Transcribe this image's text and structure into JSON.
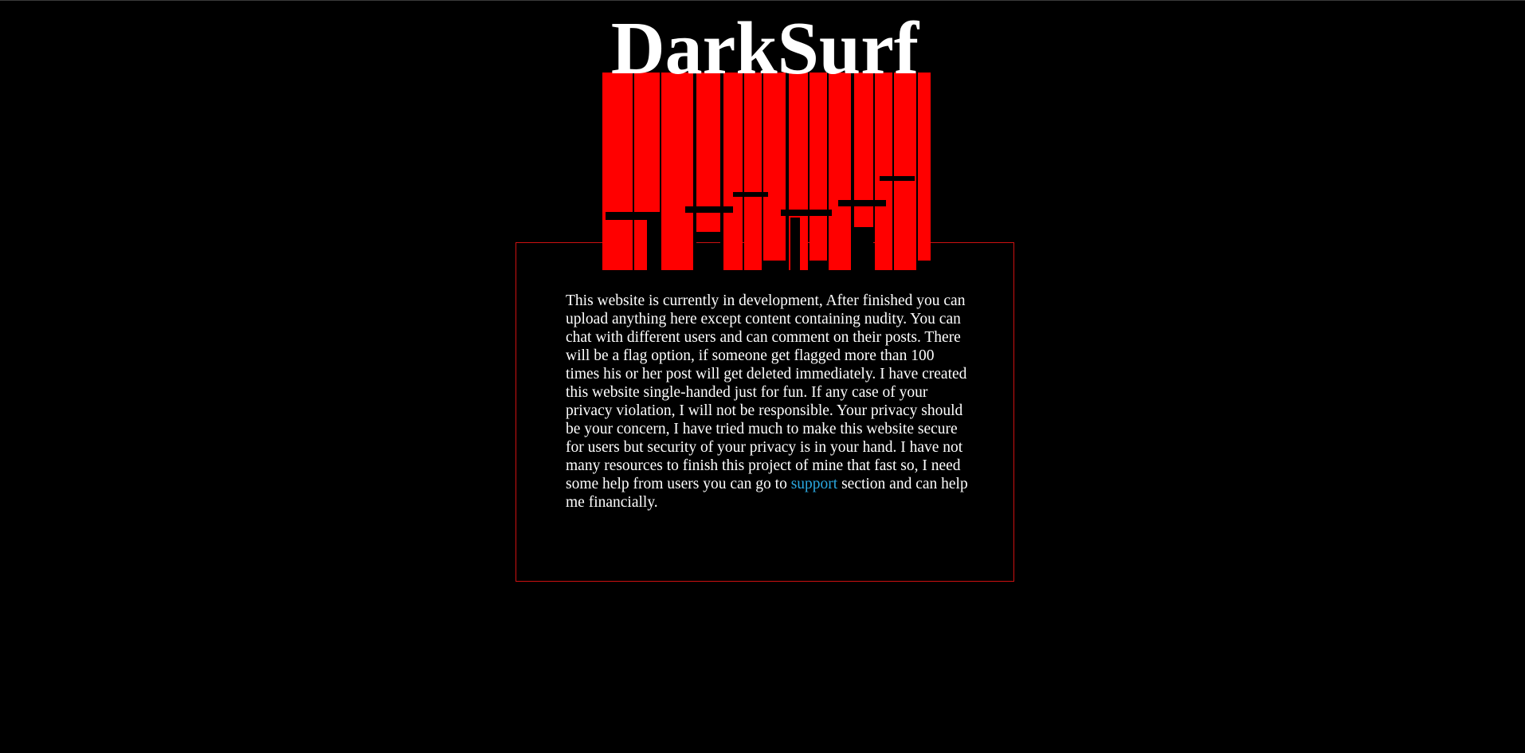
{
  "logo": {
    "title": "DarkSurf",
    "drip_color": "#ff0000",
    "title_color": "#ffffff"
  },
  "info": {
    "text_before_link": "This website is currently in development, After finished you can upload anything here except content containing nudity. You can chat with different users and can comment on their posts. There will be a flag option, if someone get flagged more than 100 times his or her post will get deleted immediately. I have created this website single-handed just for fun. If any case of your privacy violation, I will not be responsible. Your privacy should be your concern, I have tried much to make this website secure for users but security of your privacy is in your hand. I have not many resources to finish this project of mine that fast so, I need some help from users you can go to ",
    "link_text": "support",
    "text_after_link": " section and can help me financially.",
    "link_color": "#2aa8e0",
    "border_color": "#cc1111"
  }
}
